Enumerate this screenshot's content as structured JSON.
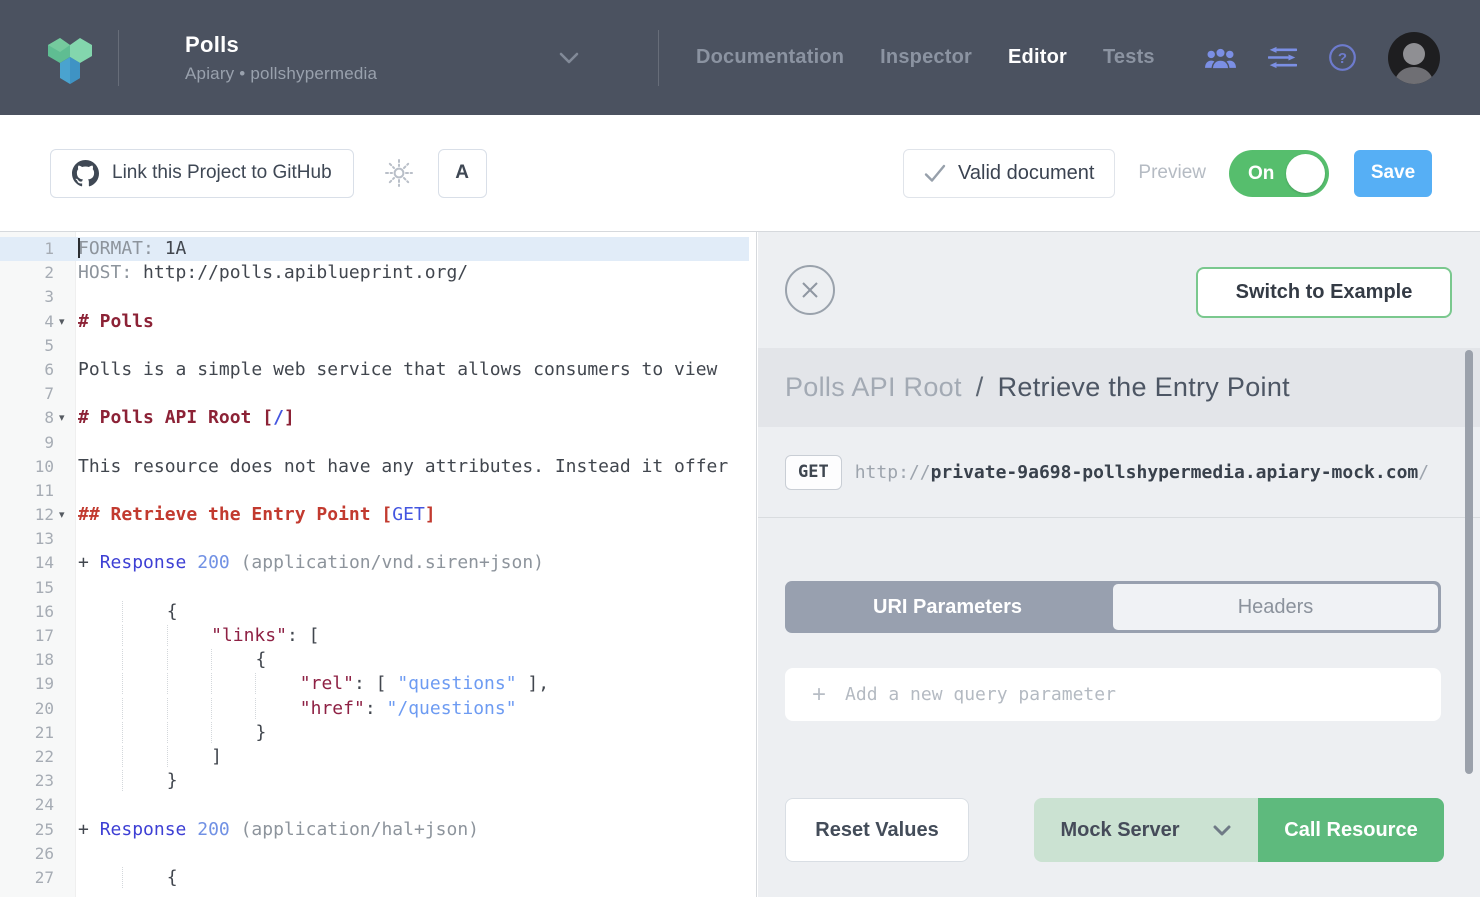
{
  "navbar": {
    "project": {
      "title": "Polls",
      "subtitle": "Apiary • pollshypermedia"
    },
    "links": [
      {
        "label": "Documentation",
        "active": false
      },
      {
        "label": "Inspector",
        "active": false
      },
      {
        "label": "Editor",
        "active": true
      },
      {
        "label": "Tests",
        "active": false
      }
    ]
  },
  "toolbar": {
    "github_label": "Link this Project to GitHub",
    "font_label": "A",
    "valid_label": "Valid document",
    "preview_label": "Preview",
    "toggle_label": "On",
    "save_label": "Save"
  },
  "editor": {
    "lines": [
      {
        "n": 1,
        "active": true,
        "cursor": true,
        "t": [
          [
            "m",
            "FORMAT:"
          ],
          [
            "p",
            " 1A"
          ]
        ]
      },
      {
        "n": 2,
        "t": [
          [
            "m",
            "HOST:"
          ],
          [
            "p",
            " http://polls.apiblueprint.org/"
          ]
        ]
      },
      {
        "n": 3
      },
      {
        "n": 4,
        "fold": true,
        "t": [
          [
            "h1",
            "# Polls"
          ]
        ]
      },
      {
        "n": 5
      },
      {
        "n": 6,
        "t": [
          [
            "p",
            "Polls is a simple web service that allows consumers to view"
          ]
        ]
      },
      {
        "n": 7
      },
      {
        "n": 8,
        "fold": true,
        "t": [
          [
            "h1",
            "# Polls API Root ["
          ],
          [
            "lkb",
            "/"
          ],
          [
            "h1",
            "]"
          ]
        ]
      },
      {
        "n": 9
      },
      {
        "n": 10,
        "t": [
          [
            "p",
            "This resource does not have any attributes. Instead it offer"
          ]
        ]
      },
      {
        "n": 11
      },
      {
        "n": 12,
        "fold": true,
        "t": [
          [
            "h2",
            "## Retrieve the Entry Point ["
          ],
          [
            "lk",
            "GET"
          ],
          [
            "h2",
            "]"
          ]
        ]
      },
      {
        "n": 13
      },
      {
        "n": 14,
        "t": [
          [
            "p",
            "+ "
          ],
          [
            "rs",
            "Response"
          ],
          [
            "p",
            " "
          ],
          [
            "n2",
            "200"
          ],
          [
            "m",
            " (application/vnd.siren+json)"
          ]
        ]
      },
      {
        "n": 15
      },
      {
        "n": 16,
        "ind": 2,
        "t": [
          [
            "p",
            "{"
          ]
        ]
      },
      {
        "n": 17,
        "ind": 3,
        "t": [
          [
            "k",
            "\"links\""
          ],
          [
            "p",
            ": ["
          ]
        ]
      },
      {
        "n": 18,
        "ind": 4,
        "t": [
          [
            "p",
            "{"
          ]
        ]
      },
      {
        "n": 19,
        "ind": 5,
        "t": [
          [
            "k",
            "\"rel\""
          ],
          [
            "p",
            ": [ "
          ],
          [
            "s",
            "\"questions\""
          ],
          [
            "p",
            " ],"
          ]
        ]
      },
      {
        "n": 20,
        "ind": 5,
        "t": [
          [
            "k",
            "\"href\""
          ],
          [
            "p",
            ": "
          ],
          [
            "s",
            "\"/questions\""
          ]
        ]
      },
      {
        "n": 21,
        "ind": 4,
        "t": [
          [
            "p",
            "}"
          ]
        ]
      },
      {
        "n": 22,
        "ind": 3,
        "t": [
          [
            "p",
            "]"
          ]
        ]
      },
      {
        "n": 23,
        "ind": 2,
        "t": [
          [
            "p",
            "}"
          ]
        ]
      },
      {
        "n": 24
      },
      {
        "n": 25,
        "t": [
          [
            "p",
            "+ "
          ],
          [
            "rs",
            "Response"
          ],
          [
            "p",
            " "
          ],
          [
            "n2",
            "200"
          ],
          [
            "m",
            " (application/hal+json)"
          ]
        ]
      },
      {
        "n": 26
      },
      {
        "n": 27,
        "ind": 2,
        "t": [
          [
            "p",
            "{"
          ]
        ]
      }
    ]
  },
  "console": {
    "switch_label": "Switch to Example",
    "breadcrumb": {
      "parent": "Polls API Root",
      "separator": "/",
      "current": "Retrieve the Entry Point"
    },
    "request": {
      "method": "GET",
      "url_scheme": "http://",
      "url_host": "private-9a698-pollshypermedia.apiary-mock.com",
      "url_path": "/"
    },
    "tabs": [
      {
        "label": "URI Parameters",
        "active": true
      },
      {
        "label": "Headers",
        "active": false
      }
    ],
    "param_placeholder": "Add a new query parameter",
    "reset_label": "Reset Values",
    "server_label": "Mock Server",
    "call_label": "Call Resource"
  },
  "colors": {
    "navbar_bg": "#4b5260",
    "panel_bg": "#edeff2",
    "toggle_green": "#56be6d",
    "save_blue": "#56aff5",
    "switch_border_green": "#7ac88e",
    "mock_light_green": "#cbe2d2",
    "call_green": "#5eba7d",
    "tab_active_gray": "#98a0af"
  }
}
